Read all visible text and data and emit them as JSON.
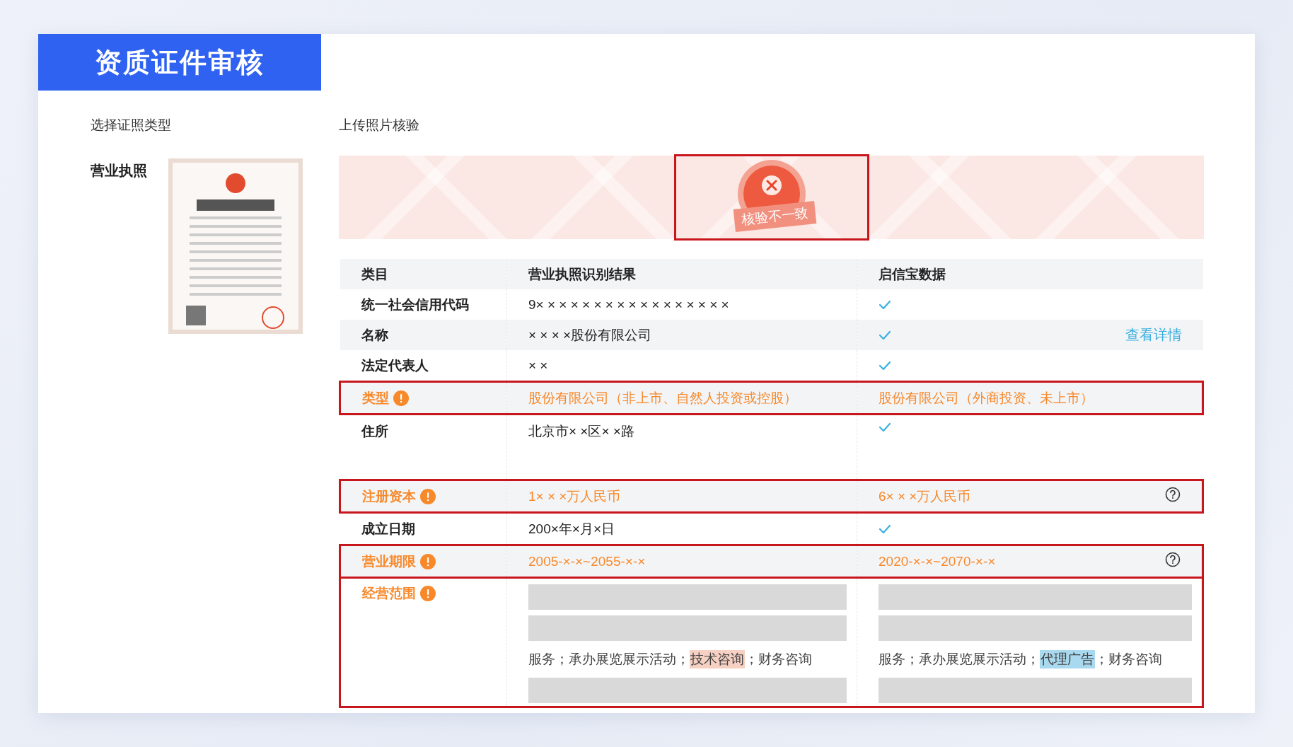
{
  "header": {
    "title": "资质证件审核"
  },
  "left": {
    "heading": "选择证照类型",
    "license_type": "营业执照"
  },
  "right": {
    "heading": "上传照片核验",
    "result": {
      "matched": false,
      "label": "核验不一致"
    }
  },
  "table": {
    "columns": [
      "类目",
      "营业执照识别结果",
      "启信宝数据"
    ],
    "rows": [
      {
        "label": "统一社会信用代码",
        "matched": true,
        "recognized": "9× × × × × × × × × × × × × × × × ×"
      },
      {
        "label": "名称",
        "matched": true,
        "recognized": "× × × ×股份有限公司",
        "link": "查看详情"
      },
      {
        "label": "法定代表人",
        "matched": true,
        "recognized": "× ×"
      },
      {
        "label": "类型",
        "matched": false,
        "recognized": "股份有限公司（非上市、自然人投资或控股）",
        "reference": "股份有限公司（外商投资、未上市）"
      },
      {
        "label": "住所",
        "matched": true,
        "recognized": "北京市× ×区× ×路",
        "tall": true
      },
      {
        "label": "注册资本",
        "matched": false,
        "recognized": "1× × ×万人民币",
        "reference": "6× × ×万人民币",
        "help": true
      },
      {
        "label": "成立日期",
        "matched": true,
        "recognized": "200×年×月×日"
      },
      {
        "label": "营业期限",
        "matched": false,
        "recognized": "2005-×-×~2055-×-×",
        "reference": "2020-×-×~2070-×-×",
        "help": true
      },
      {
        "label": "经营范围",
        "matched": false,
        "kind": "scope",
        "recognized_lines": [
          {
            "kind": "redacted"
          },
          {
            "kind": "redacted"
          },
          {
            "kind": "text",
            "before": "服务；承办展览展示活动；",
            "highlight": "技术咨询",
            "after": "；财务咨询",
            "color": "#f6d0c2"
          },
          {
            "kind": "redacted"
          }
        ],
        "reference_lines": [
          {
            "kind": "redacted"
          },
          {
            "kind": "redacted"
          },
          {
            "kind": "text",
            "before": "服务；承办展览展示活动；",
            "highlight": "代理广告",
            "after": "；财务咨询",
            "color": "#a9d9ef"
          },
          {
            "kind": "redacted"
          }
        ]
      }
    ]
  }
}
